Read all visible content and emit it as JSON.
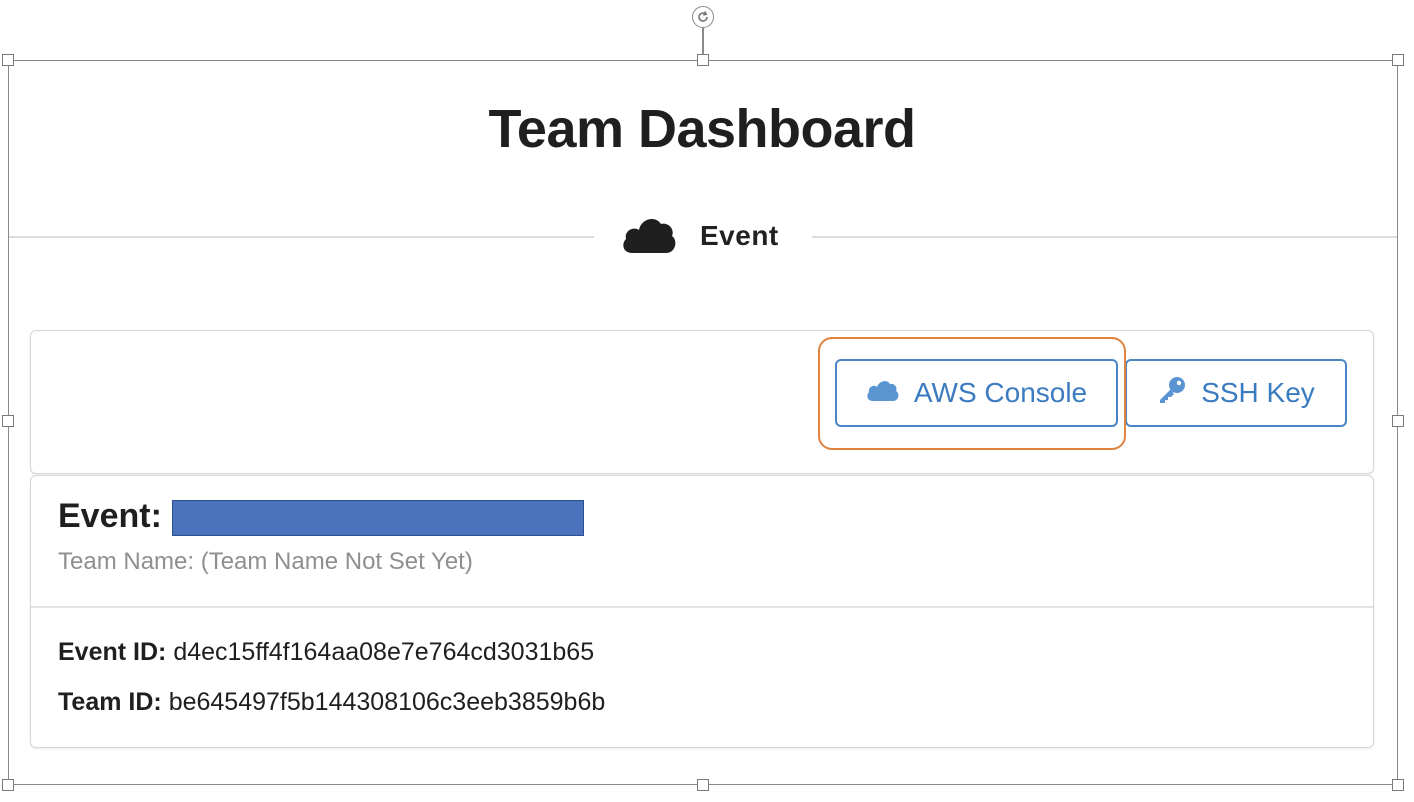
{
  "page": {
    "title": "Team Dashboard"
  },
  "section": {
    "icon": "cloud-icon",
    "label": "Event"
  },
  "actions": {
    "aws_console": {
      "label": "AWS Console",
      "icon": "cloud-icon"
    },
    "ssh_key": {
      "label": "SSH Key",
      "icon": "key-icon"
    }
  },
  "event": {
    "label": "Event:",
    "team_name": "Team Name: (Team Name Not Set Yet)",
    "event_id_label": "Event ID:",
    "event_id": "d4ec15ff4f164aa08e7e764cd3031b65",
    "team_id_label": "Team ID:",
    "team_id": "be645497f5b144308106c3eeb3859b6b"
  },
  "colors": {
    "accent": "#3b7bbf",
    "highlight": "#e0833f",
    "redaction": "#4a72bd"
  }
}
